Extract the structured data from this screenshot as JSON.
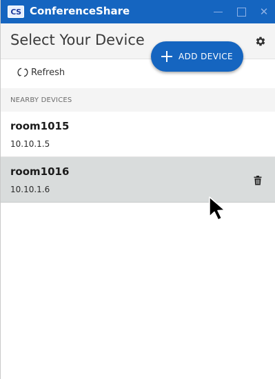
{
  "window": {
    "logo_text": "CS",
    "app_title": "ConferenceShare",
    "controls": {
      "minimize_icon": "minimize-icon",
      "maximize_icon": "maximize-icon",
      "close_icon": "close-icon",
      "close_glyph": "✕"
    }
  },
  "header": {
    "title": "Select Your Device",
    "settings_icon": "gear-icon"
  },
  "add_device": {
    "label": "ADD DEVICE",
    "icon": "plus-icon"
  },
  "refresh": {
    "label": "Refresh",
    "icon": "refresh-icon"
  },
  "section": {
    "label": "NEARBY DEVICES"
  },
  "devices": [
    {
      "name": "room1015",
      "ip": "10.10.1.5",
      "selected": false
    },
    {
      "name": "room1016",
      "ip": "10.10.1.6",
      "selected": true,
      "action_icon": "trash-icon"
    }
  ],
  "colors": {
    "accent": "#1565c0",
    "header_bg": "#f4f4f4",
    "selected_row": "#d9dcdc"
  }
}
